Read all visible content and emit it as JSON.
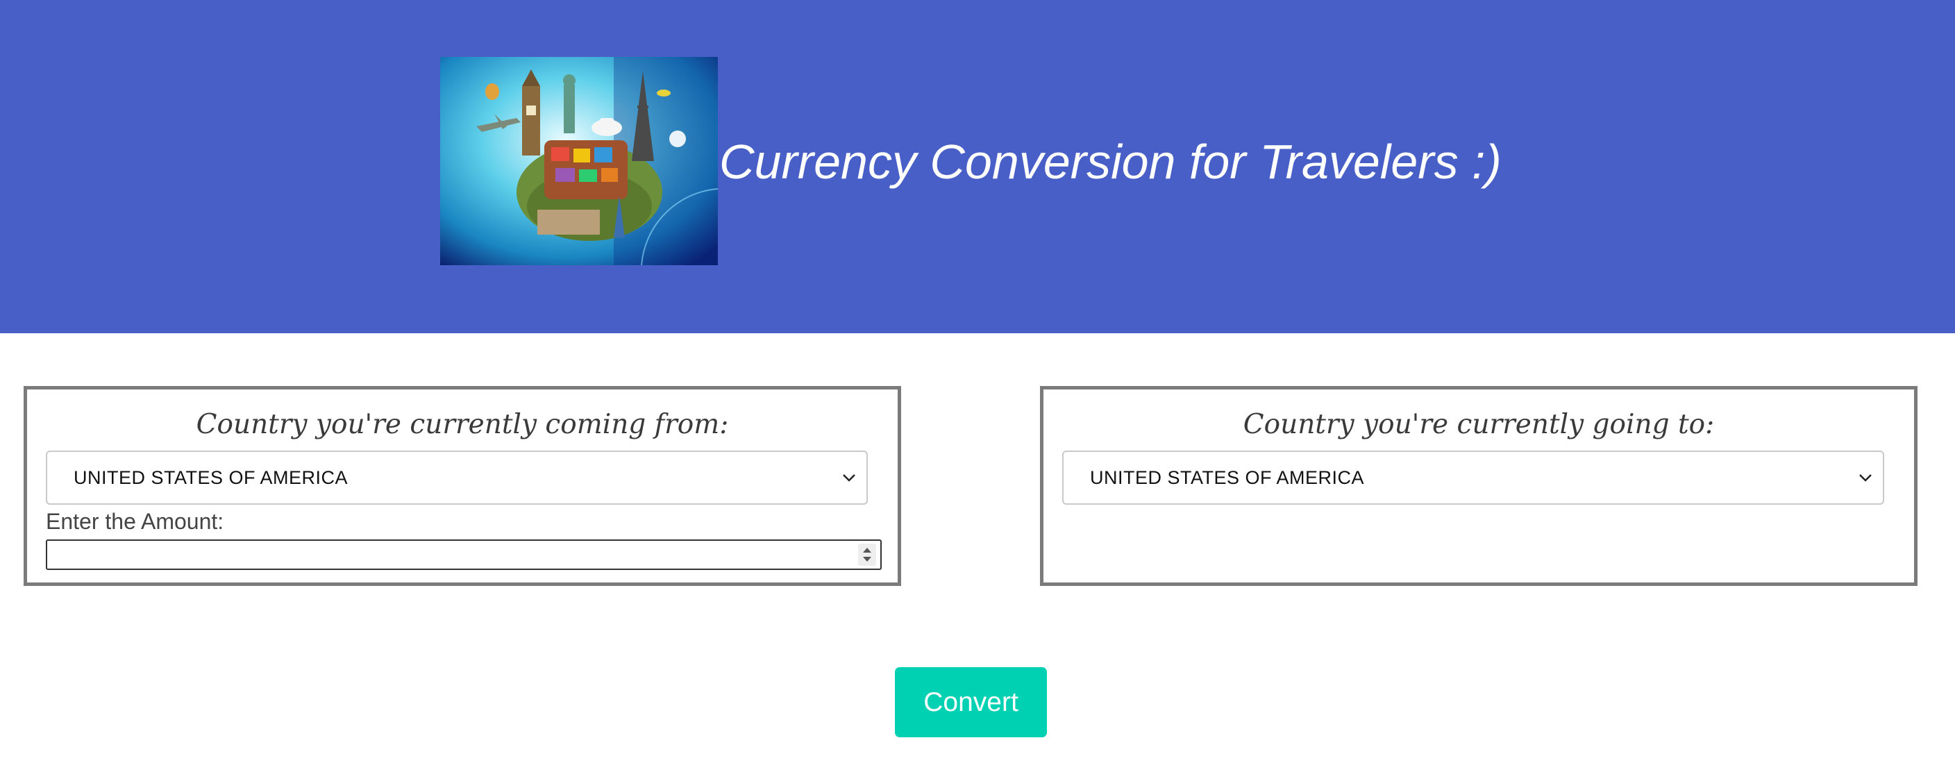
{
  "header": {
    "title": "Currency Conversion for Travelers :)",
    "background_color": "#475fc6",
    "image": "travel-landmarks-suitcase-globe"
  },
  "from_panel": {
    "heading": "Country you're currently coming from:",
    "selected_country": "UNITED STATES OF AMERICA",
    "amount_label": "Enter the Amount:",
    "amount_value": ""
  },
  "to_panel": {
    "heading": "Country you're currently going to:",
    "selected_country": "UNITED STATES OF AMERICA"
  },
  "convert_button": {
    "label": "Convert",
    "color": "#00d1b2"
  },
  "icons": {
    "select_arrow": "chevron-down-icon",
    "number_stepper": "stepper-arrows-icon"
  }
}
